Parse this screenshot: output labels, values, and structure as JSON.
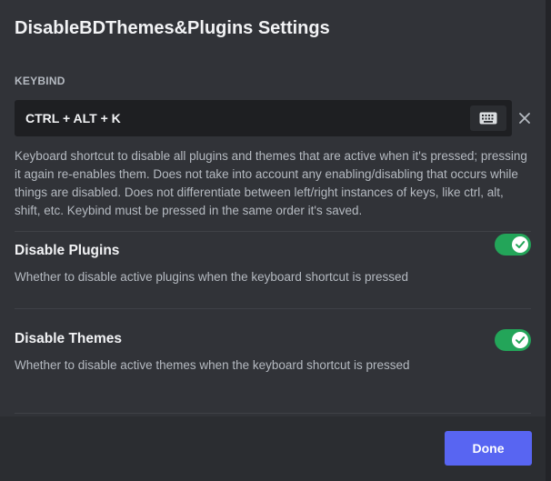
{
  "modal": {
    "title": "DisableBDThemes&Plugins Settings"
  },
  "keybind": {
    "section_label": "KEYBIND",
    "value": "CTRL + ALT + K",
    "record_icon": "keyboard-icon",
    "clear_icon": "close-icon",
    "description": "Keyboard shortcut to disable all plugins and themes that are active when it's pressed; pressing it again re-enables them. Does not take into account any enabling/disabling that occurs while things are disabled. Does not differentiate between left/right instances of keys, like ctrl, alt, shift, etc. Keybind must be pressed in the same order it's saved."
  },
  "settings": [
    {
      "title": "Disable Plugins",
      "description": "Whether to disable active plugins when the keyboard shortcut is pressed",
      "enabled": true
    },
    {
      "title": "Disable Themes",
      "description": "Whether to disable active themes when the keyboard shortcut is pressed",
      "enabled": true
    }
  ],
  "footer": {
    "done_label": "Done"
  },
  "colors": {
    "accent": "#5865f2",
    "toggle_on": "#23a559",
    "background": "#313338"
  }
}
